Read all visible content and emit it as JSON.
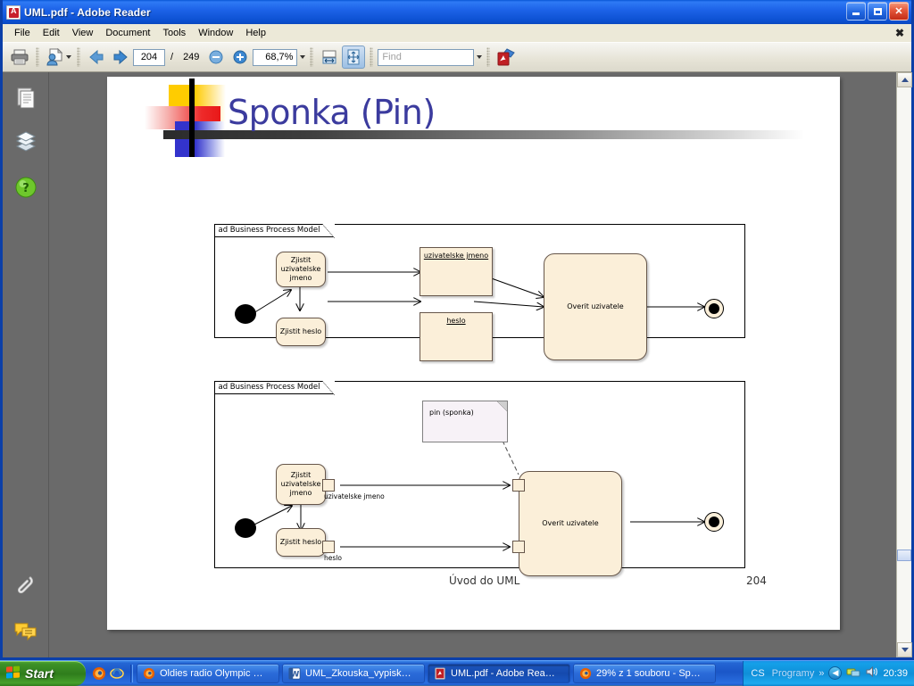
{
  "window": {
    "title": "UML.pdf - Adobe Reader",
    "icon": "adobe-pdf-icon",
    "buttons": {
      "minimize": "_",
      "maximize": "□",
      "close": "✕"
    }
  },
  "menubar": {
    "items": [
      "File",
      "Edit",
      "View",
      "Document",
      "Tools",
      "Window",
      "Help"
    ],
    "close_x": "✖"
  },
  "toolbar": {
    "print_icon": "printer-icon",
    "sign_icon": "sign-document-icon",
    "prev_icon": "previous-page-icon",
    "next_icon": "next-page-icon",
    "page_current": "204",
    "page_separator": "/",
    "page_total": "249",
    "zoom_out_icon": "zoom-out-icon",
    "zoom_in_icon": "zoom-in-icon",
    "zoom_value": "68,7%",
    "fit_width_icon": "fit-width-icon",
    "fit_page_icon": "fit-page-icon",
    "find_placeholder": "Find",
    "find_value": "",
    "acrobat_icon": "acrobat-export-icon"
  },
  "navpane": {
    "items": [
      {
        "name": "pages-panel-icon",
        "label": "Pages"
      },
      {
        "name": "layers-panel-icon",
        "label": "Layers"
      },
      {
        "name": "help-panel-icon",
        "label": "How To"
      },
      {
        "name": "attachments-panel-icon",
        "label": "Attachments"
      },
      {
        "name": "comments-panel-icon",
        "label": "Comments"
      }
    ]
  },
  "scrollbar": {
    "up": "▲",
    "down": "▼"
  },
  "slide": {
    "title": "Sponka (Pin)",
    "footer_left": "Úvod do UML",
    "footer_right": "204",
    "colors": {
      "title_text": "#3b3b9e",
      "deco_yellow": "#ffcc00",
      "deco_red": "#ee2a2a",
      "deco_blue": "#3333cc",
      "node_fill": "#fbefd9",
      "node_border": "#66564a",
      "note_fill": "#f7f2f7"
    },
    "diagram1": {
      "frame_label": "ad Business Process Model",
      "initial_node": "initial-node",
      "final_node": "final-node",
      "activities": [
        {
          "id": "a1",
          "label": "Zjistit uzivatelske jmeno"
        },
        {
          "id": "a2",
          "label": "Zjistit heslo"
        },
        {
          "id": "a3",
          "label": "Overit uzivatele"
        }
      ],
      "object_nodes": [
        {
          "id": "o1",
          "label": "uzivatelske jmeno"
        },
        {
          "id": "o2",
          "label": "heslo"
        }
      ]
    },
    "diagram2": {
      "frame_label": "ad Business Process Model",
      "initial_node": "initial-node",
      "final_node": "final-node",
      "activities": [
        {
          "id": "b1",
          "label": "Zjistit uzivatelske jmeno"
        },
        {
          "id": "b2",
          "label": "Zjistit heslo"
        },
        {
          "id": "b3",
          "label": "Overit uzivatele"
        }
      ],
      "pins": [
        {
          "id": "p1",
          "label": "uzivatelske jmeno"
        },
        {
          "id": "p2",
          "label": "heslo"
        }
      ],
      "note": {
        "text": "pin (sponka)"
      }
    }
  },
  "taskbar": {
    "start_label": "Start",
    "quick_launch": [
      {
        "name": "firefox-quicklaunch-icon"
      },
      {
        "name": "internet-explorer-quicklaunch-icon"
      }
    ],
    "tasks": [
      {
        "icon": "firefox-icon",
        "label": "Oldies radio Olympic …",
        "active": false
      },
      {
        "icon": "word-icon",
        "label": "UML_Zkouska_vypisk…",
        "active": false
      },
      {
        "icon": "adobe-reader-icon",
        "label": "UML.pdf - Adobe Rea…",
        "active": true
      },
      {
        "icon": "firefox-icon",
        "label": "29% z 1 souboru - Sp…",
        "active": false
      }
    ],
    "tray": {
      "language": "CS",
      "programy_label": "Programy",
      "chevron": "»",
      "icons": [
        "show-hidden-icon",
        "network-icon",
        "volume-icon"
      ],
      "clock": "20:39"
    }
  }
}
